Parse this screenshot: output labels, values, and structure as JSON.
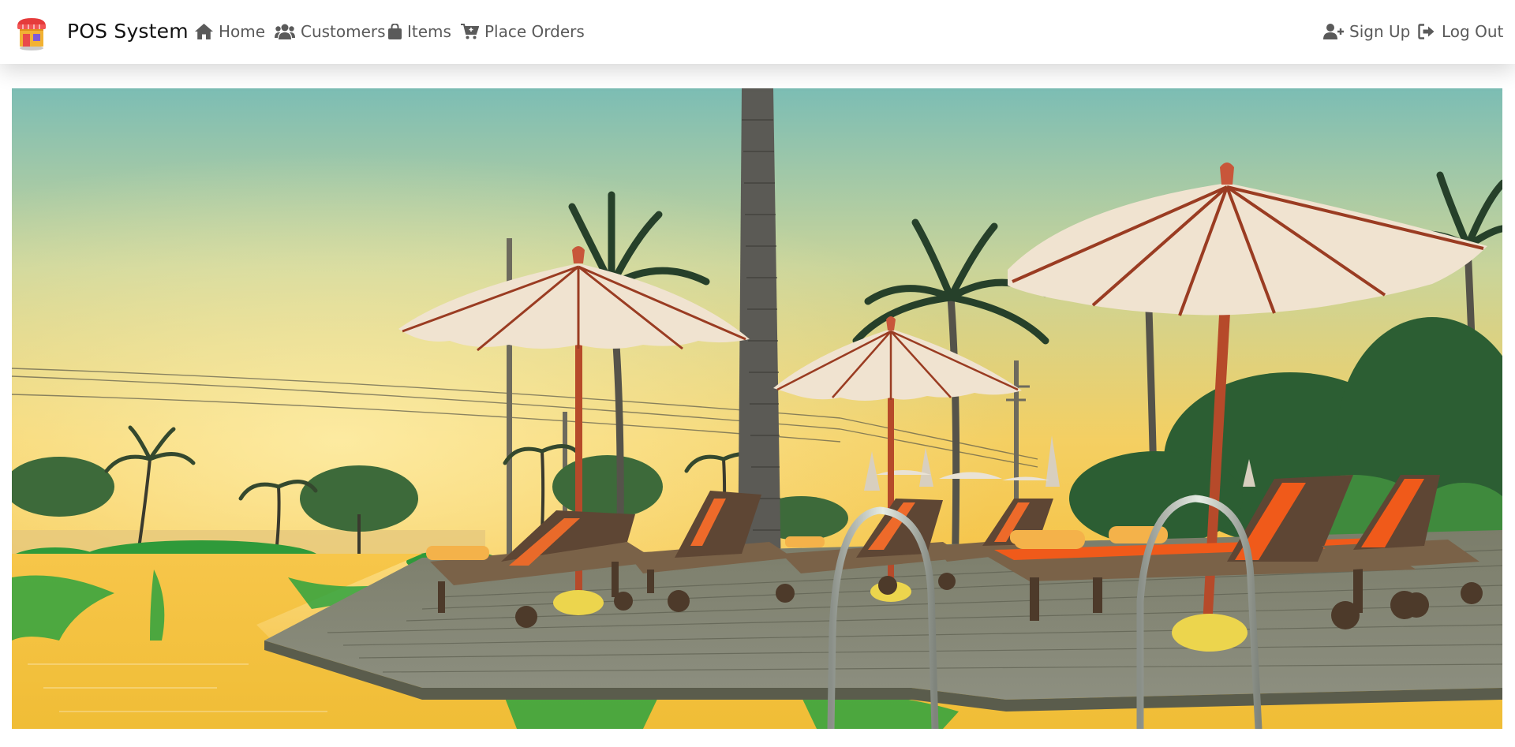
{
  "brand": {
    "name": "POS System",
    "logo_icon": "shop-icon"
  },
  "nav": {
    "left": [
      {
        "label": "Home",
        "icon": "home-icon"
      },
      {
        "label": "Customers",
        "icon": "users-icon"
      },
      {
        "label": "Items",
        "icon": "shopping-bag-icon"
      },
      {
        "label": "Place Orders",
        "icon": "cart-icon"
      }
    ],
    "right": [
      {
        "label": "Sign Up",
        "icon": "user-plus-icon"
      },
      {
        "label": "Log Out",
        "icon": "sign-out-icon"
      }
    ]
  },
  "colors": {
    "nav_text": "#5a5a5a",
    "brand_text": "#111111",
    "sky_top": "#6fb8b8",
    "sky_bottom": "#f5c94a",
    "umbrella": "#efe2cf",
    "lounger_cushion": "#f05a1a"
  },
  "hero": {
    "subject": "tropical pool deck at sunset with umbrellas and sun loungers"
  }
}
